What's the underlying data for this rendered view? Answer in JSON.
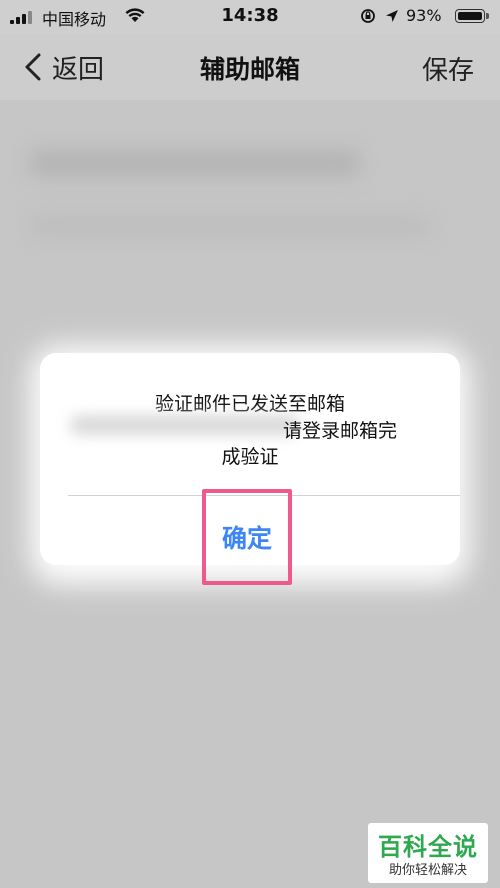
{
  "status_bar": {
    "carrier": "中国移动",
    "time": "14:38",
    "battery_percent": "93%"
  },
  "nav": {
    "back_label": "返回",
    "title": "辅助邮箱",
    "save_label": "保存"
  },
  "dialog": {
    "line1": "验证邮件已发送至邮箱",
    "line2_visible": "请登录邮箱完",
    "line3": "成验证",
    "confirm_label": "确定"
  },
  "watermark": {
    "title": "百科全说",
    "subtitle": "助你轻松解决"
  },
  "colors": {
    "accent": "#3e86f5",
    "highlight_box": "#ef5a8a",
    "watermark_green": "#2fa84f",
    "background": "#c6c6c6"
  }
}
